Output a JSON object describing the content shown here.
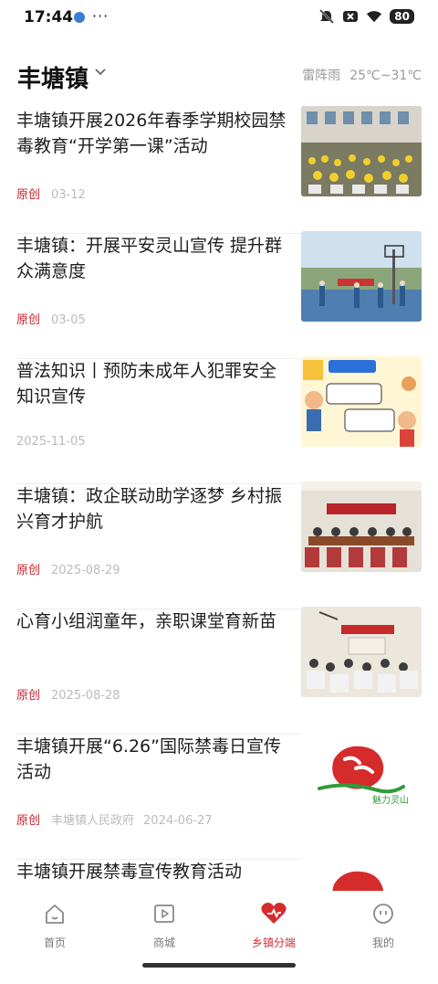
{
  "status_bar": {
    "time": "17:44",
    "battery": "80"
  },
  "header": {
    "town": "丰塘镇",
    "weather_desc": "雷阵雨",
    "temperature": "25℃~31℃"
  },
  "articles": [
    {
      "title": "丰塘镇开展2026年春季学期校园禁毒教育“开学第一课”活动",
      "tag": "原创",
      "source": "",
      "date": "03-12",
      "thumb": "school-assembly-photo"
    },
    {
      "title": "丰塘镇：开展平安灵山宣传 提升群众满意度",
      "tag": "原创",
      "source": "",
      "date": "03-05",
      "thumb": "basketball-court-photo"
    },
    {
      "title": "普法知识丨预防未成年人犯罪安全知识宣传",
      "tag": "",
      "source": "",
      "date": "2025-11-05",
      "thumb": "law-cartoon-image"
    },
    {
      "title": "丰塘镇：政企联动助学逐梦 乡村振兴育才护航",
      "tag": "原创",
      "source": "",
      "date": "2025-08-29",
      "thumb": "meeting-room-photo"
    },
    {
      "title": "心育小组润童年，亲职课堂育新苗",
      "tag": "原创",
      "source": "",
      "date": "2025-08-28",
      "thumb": "classroom-photo"
    },
    {
      "title": "丰塘镇开展“6.26”国际禁毒日宣传活动",
      "tag": "原创",
      "source": "丰塘镇人民政府",
      "date": "2024-06-27",
      "thumb": "lingshan-logo"
    },
    {
      "title": "丰塘镇开展禁毒宣传教育活动",
      "tag": "",
      "source": "",
      "date": "",
      "thumb": "lingshan-logo"
    }
  ],
  "thumb_logo_text": "魅力灵山",
  "bottom_nav": [
    {
      "label": "首页",
      "icon": "home-icon",
      "active": false
    },
    {
      "label": "商城",
      "icon": "video-play-icon",
      "active": false
    },
    {
      "label": "乡镇分端",
      "icon": "heart-icon",
      "active": true
    },
    {
      "label": "我的",
      "icon": "smiley-face-icon",
      "active": false
    }
  ],
  "colors": {
    "accent": "#d62b2b",
    "tag": "#c8242c",
    "muted": "#bbbbbb"
  }
}
